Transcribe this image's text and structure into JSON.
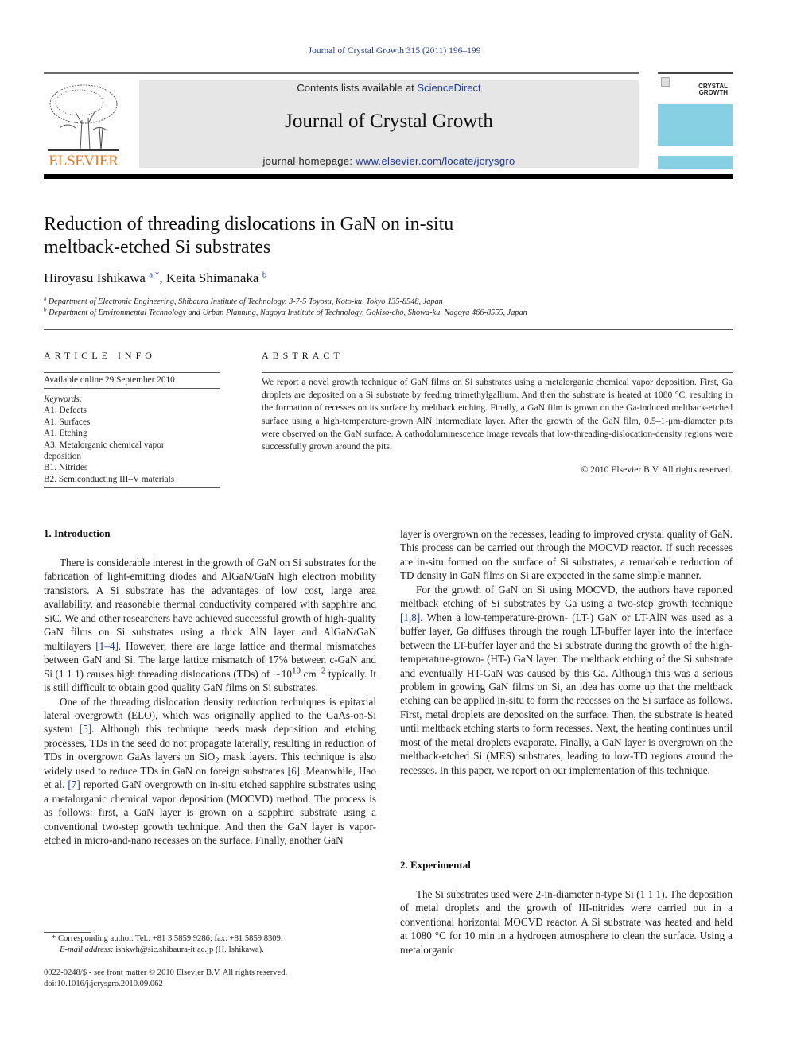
{
  "running_head": "Journal of Crystal Growth 315 (2011) 196–199",
  "masthead": {
    "publisher_logo": "ELSEVIER",
    "contents_prefix": "Contents lists available at ",
    "contents_link": "ScienceDirect",
    "journal_name": "Journal of Crystal Growth",
    "homepage_prefix": "journal homepage: ",
    "homepage_url": "www.elsevier.com/locate/jcrysgro",
    "cover_title_line1": "CRYSTAL",
    "cover_title_line2": "GROWTH"
  },
  "article": {
    "title_line1": "Reduction of threading dislocations in GaN on in-situ",
    "title_line2": "meltback-etched Si substrates",
    "authors": [
      {
        "name": "Hiroyasu Ishikawa",
        "sup": "a,*"
      },
      {
        "name": "Keita Shimanaka",
        "sup": "b"
      }
    ],
    "affiliations": [
      {
        "mark": "a",
        "text": "Department of Electronic Engineering, Shibaura Institute of Technology, 3-7-5 Toyosu, Koto-ku, Tokyo 135-8548, Japan"
      },
      {
        "mark": "b",
        "text": "Department of Environmental Technology and Urban Planning, Nagoya Institute of Technology, Gokiso-cho, Showa-ku, Nagoya 466-8555, Japan"
      }
    ]
  },
  "article_info": {
    "heading": "ARTICLE INFO",
    "available": "Available online 29 September 2010",
    "keywords_label": "Keywords:",
    "keywords": [
      "A1. Defects",
      "A1. Surfaces",
      "A1. Etching",
      "A3. Metalorganic chemical vapor deposition",
      "B1. Nitrides",
      "B2. Semiconducting III–V materials"
    ]
  },
  "abstract": {
    "heading": "ABSTRACT",
    "text": "We report a novel growth technique of GaN films on Si substrates using a metalorganic chemical vapor deposition. First, Ga droplets are deposited on a Si substrate by feeding trimethylgallium. And then the substrate is heated at 1080 °C, resulting in the formation of recesses on its surface by meltback etching. Finally, a GaN film is grown on the Ga-induced meltback-etched surface using a high-temperature-grown AlN intermediate layer. After the growth of the GaN film, 0.5–1-μm-diameter pits were observed on the GaN surface. A cathodoluminescence image reveals that low-threading-dislocation-density regions were successfully grown around the pits.",
    "copyright": "© 2010 Elsevier B.V. All rights reserved."
  },
  "sections": {
    "intro_heading": "1.  Introduction",
    "intro_p1_a": "There is considerable interest in the growth of GaN on Si substrates for the fabrication of light-emitting diodes and AlGaN/GaN high electron mobility transistors. A Si substrate has the advantages of low cost, large area availability, and reasonable thermal conductivity compared with sapphire and SiC. We and other researchers have achieved successful growth of high-quality GaN films on Si substrates using a thick AlN layer and AlGaN/GaN multilayers ",
    "intro_p1_cite1": "[1–4]",
    "intro_p1_b": ". However, there are large lattice and thermal mismatches between GaN and Si. The large lattice mismatch of 17% between c-GaN and Si (1 1 1) causes high threading dislocations (TDs) of ∼10",
    "intro_p1_sup1": "10",
    "intro_p1_c": " cm",
    "intro_p1_sup2": "−2",
    "intro_p1_d": " typically. It is still difficult to obtain good quality GaN films on Si substrates.",
    "intro_p2_a": "One of the threading dislocation density reduction techniques is epitaxial lateral overgrowth (ELO), which was originally applied to the GaAs-on-Si system ",
    "intro_p2_cite5": "[5]",
    "intro_p2_b": ". Although this technique needs mask deposition and etching processes, TDs in the seed do not propagate laterally, resulting in reduction of TDs in overgrown GaAs layers on SiO",
    "intro_p2_sub": "2",
    "intro_p2_c": " mask layers. This technique is also widely used to reduce TDs in GaN on foreign substrates ",
    "intro_p2_cite6": "[6]",
    "intro_p2_d": ". Meanwhile, Hao et al. ",
    "intro_p2_cite7": "[7]",
    "intro_p2_e": " reported GaN overgrowth on in-situ etched sapphire substrates using a metalorganic chemical vapor deposition (MOCVD) method. The process is as follows: first, a GaN layer is grown on a sapphire substrate using a conventional two-step growth technique. And then the GaN layer is vapor-etched in micro-and-nano recesses on the surface. Finally, another GaN",
    "col2_p1": "layer is overgrown on the recesses, leading to improved crystal quality of GaN. This process can be carried out through the MOCVD reactor. If such recesses are in-situ formed on the surface of Si substrates, a remarkable reduction of TD density in GaN films on Si are expected in the same simple manner.",
    "col2_p2_a": "For the growth of GaN on Si using MOCVD, the authors have reported meltback etching of Si substrates by Ga using a two-step growth technique ",
    "col2_p2_cite": "[1,8]",
    "col2_p2_b": ". When a low-temperature-grown- (LT-) GaN or LT-AlN was used as a buffer layer, Ga diffuses through the rough LT-buffer layer into the interface between the LT-buffer layer and the Si substrate during the growth of the high-temperature-grown- (HT-) GaN layer. The meltback etching of the Si substrate and eventually HT-GaN was caused by this Ga. Although this was a serious problem in growing GaN films on Si, an idea has come up that the meltback etching can be applied in-situ to form the recesses on the Si surface as follows. First, metal droplets are deposited on the surface. Then, the substrate is heated until meltback etching starts to form recesses. Next, the heating continues until most of the metal droplets evaporate. Finally, a GaN layer is overgrown on the meltback-etched Si (MES) substrates, leading to low-TD regions around the recesses. In this paper, we report on our implementation of this technique.",
    "exp_heading": "2.  Experimental",
    "exp_p1": "The Si substrates used were 2-in-diameter n-type Si (1 1 1). The deposition of metal droplets and the growth of III-nitrides were carried out in a conventional horizontal MOCVD reactor. A Si substrate was heated and held at 1080 °C for 10 min in a hydrogen atmosphere to clean the surface. Using a metalorganic"
  },
  "footnote": {
    "corresponding": "* Corresponding author. Tel.: +81 3 5859 9286; fax: +81 5859 8309.",
    "email_label": "E-mail address:",
    "email": " ishkwh@sic.shibaura-it.ac.jp (H. Ishikawa)."
  },
  "front_matter": {
    "issn": "0022-0248/$ - see front matter © 2010 Elsevier B.V. All rights reserved.",
    "doi": "doi:10.1016/j.jcrysgro.2010.09.062"
  }
}
